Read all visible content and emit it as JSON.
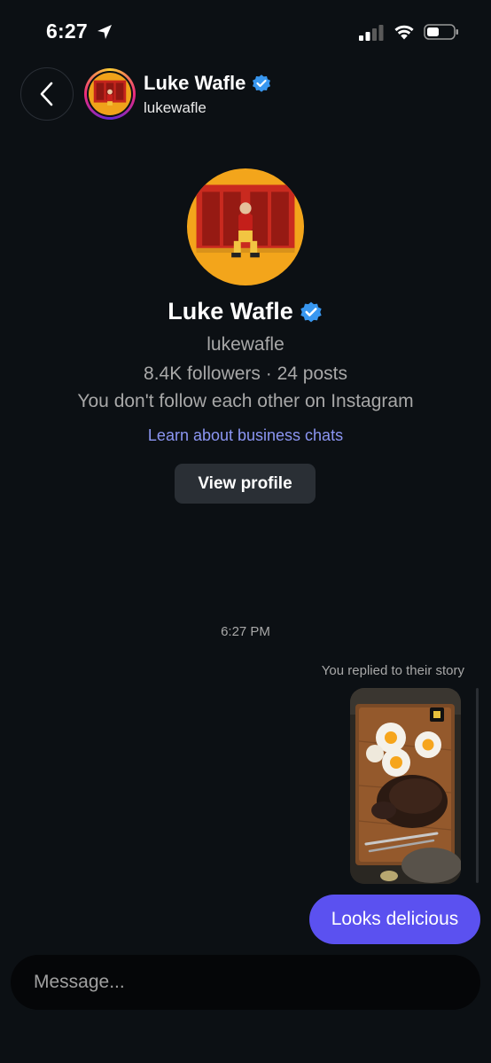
{
  "status_bar": {
    "time": "6:27",
    "icons": [
      "location-arrow-icon",
      "cellular-signal-icon",
      "wifi-icon",
      "battery-icon"
    ]
  },
  "header": {
    "name": "Luke Wafle",
    "username": "lukewafle",
    "verified": true,
    "icons": [
      "back-chevron-icon",
      "verified-badge-icon"
    ]
  },
  "profile": {
    "name": "Luke Wafle",
    "username": "lukewafle",
    "stats": "8.4K followers · 24 posts",
    "follow_status": "You don't follow each other on Instagram",
    "learn_link": "Learn about business chats",
    "view_profile_label": "View profile"
  },
  "chat": {
    "timestamp": "6:27 PM",
    "story_reply_label": "You replied to their story",
    "messages": [
      {
        "from": "me",
        "text": "Looks delicious"
      }
    ]
  },
  "composer": {
    "placeholder": "Message..."
  },
  "colors": {
    "background": "#0c1014",
    "bubble": "#5b51f0",
    "link": "#8c96f3",
    "verified": "#3897f0",
    "secondary_text": "#a8a8a8"
  }
}
